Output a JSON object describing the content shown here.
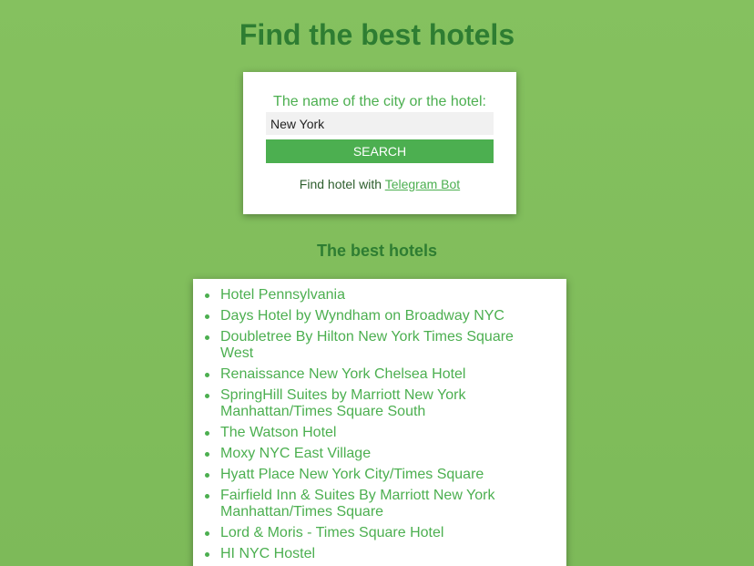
{
  "header": {
    "title": "Find the best hotels"
  },
  "search": {
    "label": "The name of the city or the hotel:",
    "value": "New York",
    "button_label": "SEARCH",
    "telegram_prefix": "Find hotel with ",
    "telegram_link": "Telegram Bot"
  },
  "results": {
    "heading": "The best hotels",
    "hotels": [
      "Hotel Pennsylvania",
      "Days Hotel by Wyndham on Broadway NYC",
      "Doubletree By Hilton New York Times Square West",
      "Renaissance New York Chelsea Hotel",
      "SpringHill Suites by Marriott New York Manhattan/Times Square South",
      "The Watson Hotel",
      "Moxy NYC East Village",
      "Hyatt Place New York City/Times Square",
      "Fairfield Inn & Suites By Marriott New York Manhattan/Times Square",
      "Lord & Moris - Times Square Hotel",
      "HI NYC Hostel"
    ]
  },
  "colors": {
    "background": "#7dba59",
    "accent": "#4caf50",
    "heading": "#2e7d32",
    "card": "#ffffff"
  }
}
